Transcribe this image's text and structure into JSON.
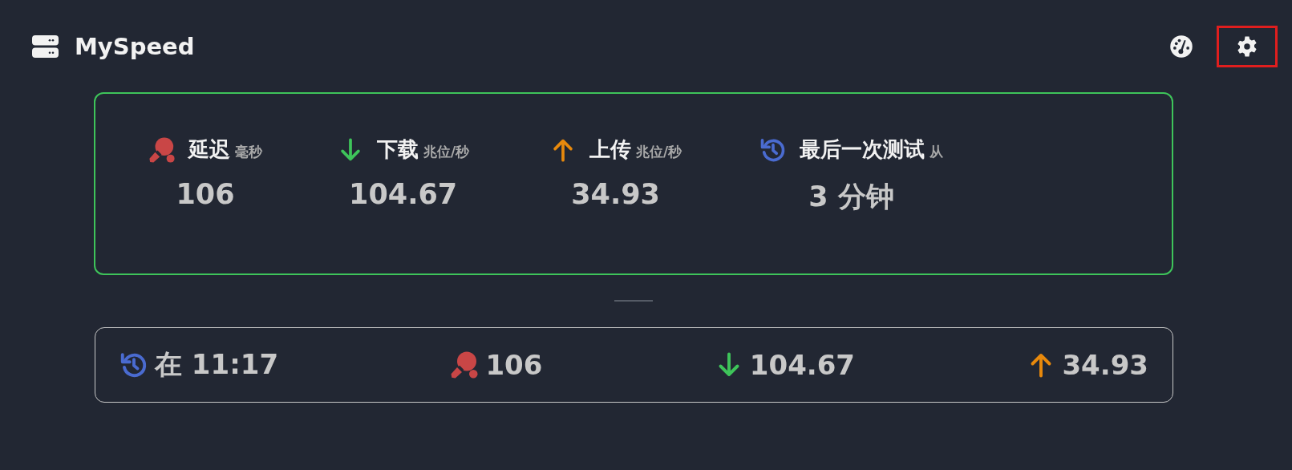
{
  "header": {
    "title": "MySpeed",
    "buttons": [
      {
        "kind": "speedometer",
        "highlighted": false
      },
      {
        "kind": "settings",
        "highlighted": true
      }
    ]
  },
  "stats": [
    {
      "kind": "ping",
      "label": "延迟",
      "unit": "毫秒",
      "value": "106"
    },
    {
      "kind": "download",
      "label": "下载",
      "unit": "兆位/秒",
      "value": "104.67"
    },
    {
      "kind": "upload",
      "label": "上传",
      "unit": "兆位/秒",
      "value": "34.93"
    },
    {
      "kind": "history",
      "label": "最后一次测试",
      "unit": "从",
      "value": "3 分钟"
    }
  ],
  "latest": [
    {
      "kind": "history",
      "text": "在 11:17"
    },
    {
      "kind": "ping",
      "text": "106"
    },
    {
      "kind": "download",
      "text": "104.67"
    },
    {
      "kind": "upload",
      "text": "34.93"
    }
  ]
}
